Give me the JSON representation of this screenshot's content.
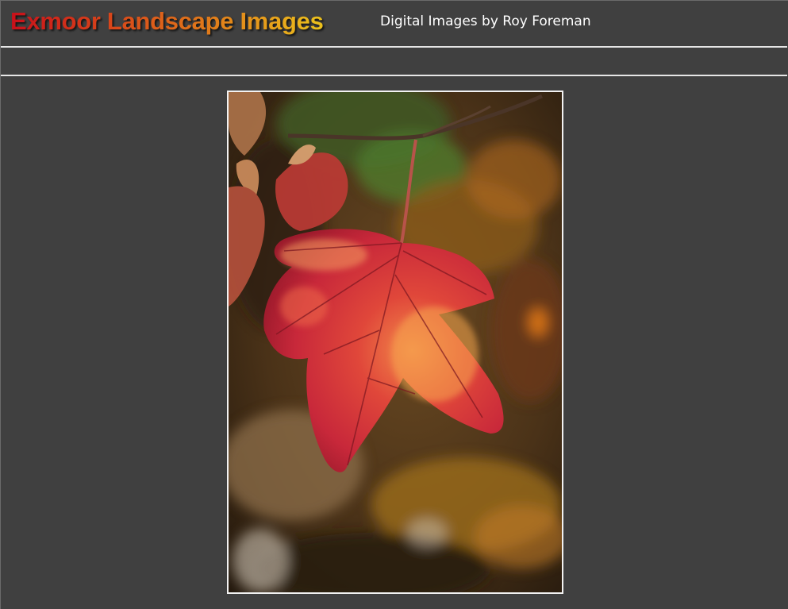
{
  "header": {
    "title": "Exmoor Landscape Images",
    "subtitle": "Digital Images by Roy Foreman"
  },
  "photo": {
    "subject": "red-autumn-leaf-photo"
  },
  "colors": {
    "background": "#404040",
    "rule": "#e6e6e6",
    "title_gradient_start": "#c8101a",
    "title_gradient_end": "#ecc21c",
    "subtitle": "#ffffff",
    "photo_border": "#f2f2f2"
  }
}
